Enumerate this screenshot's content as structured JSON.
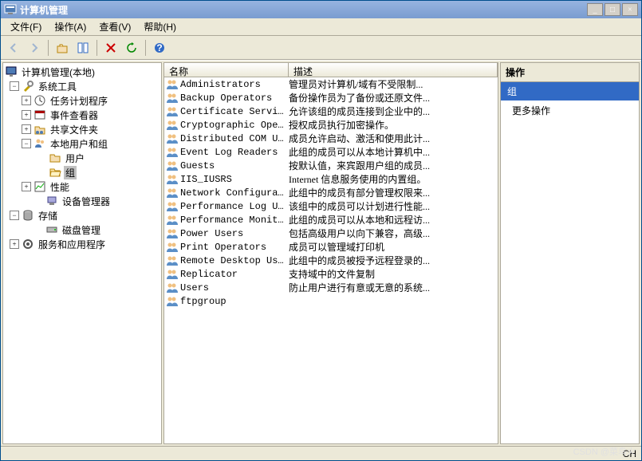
{
  "title": "计算机管理",
  "menu": {
    "file": "文件(F)",
    "action": "操作(A)",
    "view": "查看(V)",
    "help": "帮助(H)"
  },
  "tree": {
    "root": "计算机管理(本地)",
    "system_tools": "系统工具",
    "task_scheduler": "任务计划程序",
    "event_viewer": "事件查看器",
    "shared_folders": "共享文件夹",
    "local_users_groups": "本地用户和组",
    "users": "用户",
    "groups": "组",
    "performance": "性能",
    "device_manager": "设备管理器",
    "storage": "存储",
    "disk_management": "磁盘管理",
    "services_apps": "服务和应用程序"
  },
  "list": {
    "col_name": "名称",
    "col_desc": "描述",
    "rows": [
      {
        "name": "Administrators",
        "desc": "管理员对计算机/域有不受限制..."
      },
      {
        "name": "Backup Operators",
        "desc": "备份操作员为了备份或还原文件..."
      },
      {
        "name": "Certificate Servic...",
        "desc": "允许该组的成员连接到企业中的..."
      },
      {
        "name": "Cryptographic Oper...",
        "desc": "授权成员执行加密操作。"
      },
      {
        "name": "Distributed COM Users",
        "desc": "成员允许启动、激活和使用此计..."
      },
      {
        "name": "Event Log Readers",
        "desc": "此组的成员可以从本地计算机中..."
      },
      {
        "name": "Guests",
        "desc": "按默认值，来宾跟用户组的成员..."
      },
      {
        "name": "IIS_IUSRS",
        "desc": "Internet 信息服务使用的内置组。"
      },
      {
        "name": "Network Configurat...",
        "desc": "此组中的成员有部分管理权限来..."
      },
      {
        "name": "Performance Log Users",
        "desc": "该组中的成员可以计划进行性能..."
      },
      {
        "name": "Performance Monito...",
        "desc": "此组的成员可以从本地和远程访..."
      },
      {
        "name": "Power Users",
        "desc": "包括高级用户以向下兼容，高级..."
      },
      {
        "name": "Print Operators",
        "desc": "成员可以管理域打印机"
      },
      {
        "name": "Remote Desktop Users",
        "desc": "此组中的成员被授予远程登录的..."
      },
      {
        "name": "Replicator",
        "desc": "支持域中的文件复制"
      },
      {
        "name": "Users",
        "desc": "防止用户进行有意或无意的系统..."
      },
      {
        "name": "ftpgroup",
        "desc": ""
      }
    ]
  },
  "actions": {
    "header": "操作",
    "subheader": "组",
    "more": "更多操作"
  },
  "status": {
    "ime": "CH"
  },
  "watermark": "CSDN @菜鸟火"
}
